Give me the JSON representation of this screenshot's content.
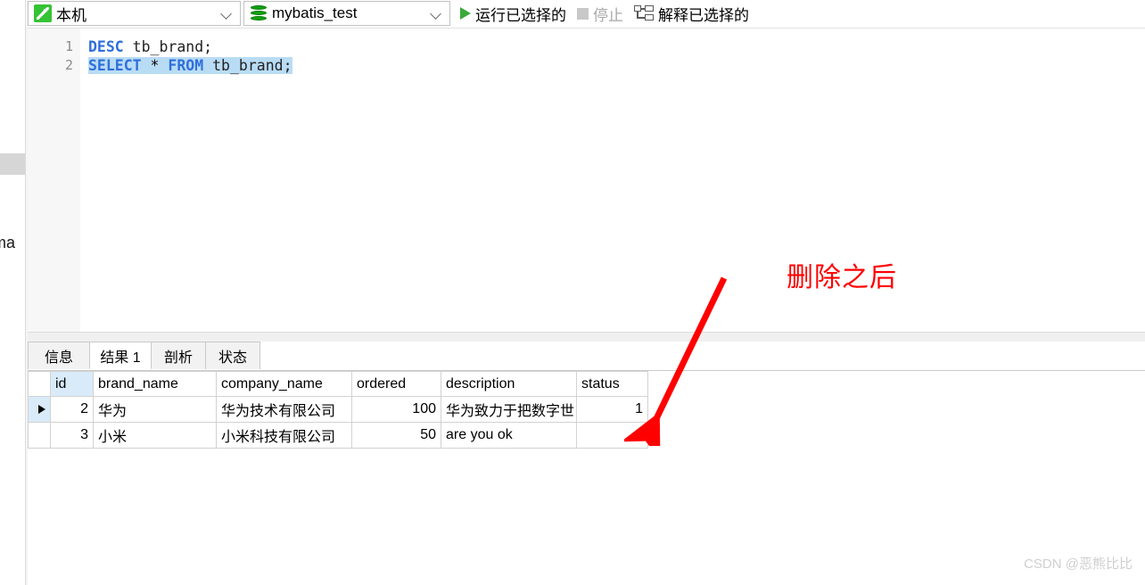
{
  "sidebar": {
    "clipped_label": "ema",
    "block_name": "panel-block"
  },
  "toolbar": {
    "host_selector": {
      "icon": "mysql-dolphin-icon",
      "value": "本机",
      "chevron": "chevron-down-icon"
    },
    "database_selector": {
      "icon": "database-icon",
      "value": "mybatis_test",
      "chevron": "chevron-down-icon"
    },
    "run_selected": {
      "icon": "play-icon",
      "label": "运行已选择的",
      "enabled": true
    },
    "stop": {
      "icon": "stop-icon",
      "label": "停止",
      "enabled": false
    },
    "explain_selected": {
      "icon": "explain-tree-icon",
      "label": "解释已选择的",
      "enabled": true
    }
  },
  "editor": {
    "lines": [
      {
        "number": "1",
        "tokens": [
          {
            "text": "DESC",
            "type": "kw"
          },
          {
            "text": " tb_brand;",
            "type": "idn"
          }
        ],
        "selected": false
      },
      {
        "number": "2",
        "tokens": [
          {
            "text": "SELECT",
            "type": "kw"
          },
          {
            "text": " * ",
            "type": "op"
          },
          {
            "text": "FROM",
            "type": "kw"
          },
          {
            "text": " tb_brand;",
            "type": "idn"
          }
        ],
        "selected": true
      }
    ],
    "line1_plain": "DESC tb_brand;",
    "line2_plain": "SELECT * FROM tb_brand;"
  },
  "result_panel": {
    "tabs": [
      {
        "label": "信息",
        "active": false
      },
      {
        "label": "结果 1",
        "active": true
      },
      {
        "label": "剖析",
        "active": false
      },
      {
        "label": "状态",
        "active": false
      }
    ]
  },
  "grid": {
    "columns": [
      "id",
      "brand_name",
      "company_name",
      "ordered",
      "description",
      "status"
    ],
    "selected_column": "id",
    "rows": [
      {
        "current": true,
        "id": "2",
        "brand_name": "华为",
        "company_name": "华为技术有限公司",
        "ordered": "100",
        "description": "华为致力于把数字世",
        "status": "1"
      },
      {
        "current": false,
        "id": "3",
        "brand_name": "小米",
        "company_name": "小米科技有限公司",
        "ordered": "50",
        "description": "are you ok",
        "status": "1"
      }
    ]
  },
  "annotations": {
    "note_text": "删除之后",
    "note_color": "#ff0000",
    "arrow_name": "red-arrow-annotation"
  },
  "watermark": {
    "text": "CSDN @恶熊比比"
  }
}
